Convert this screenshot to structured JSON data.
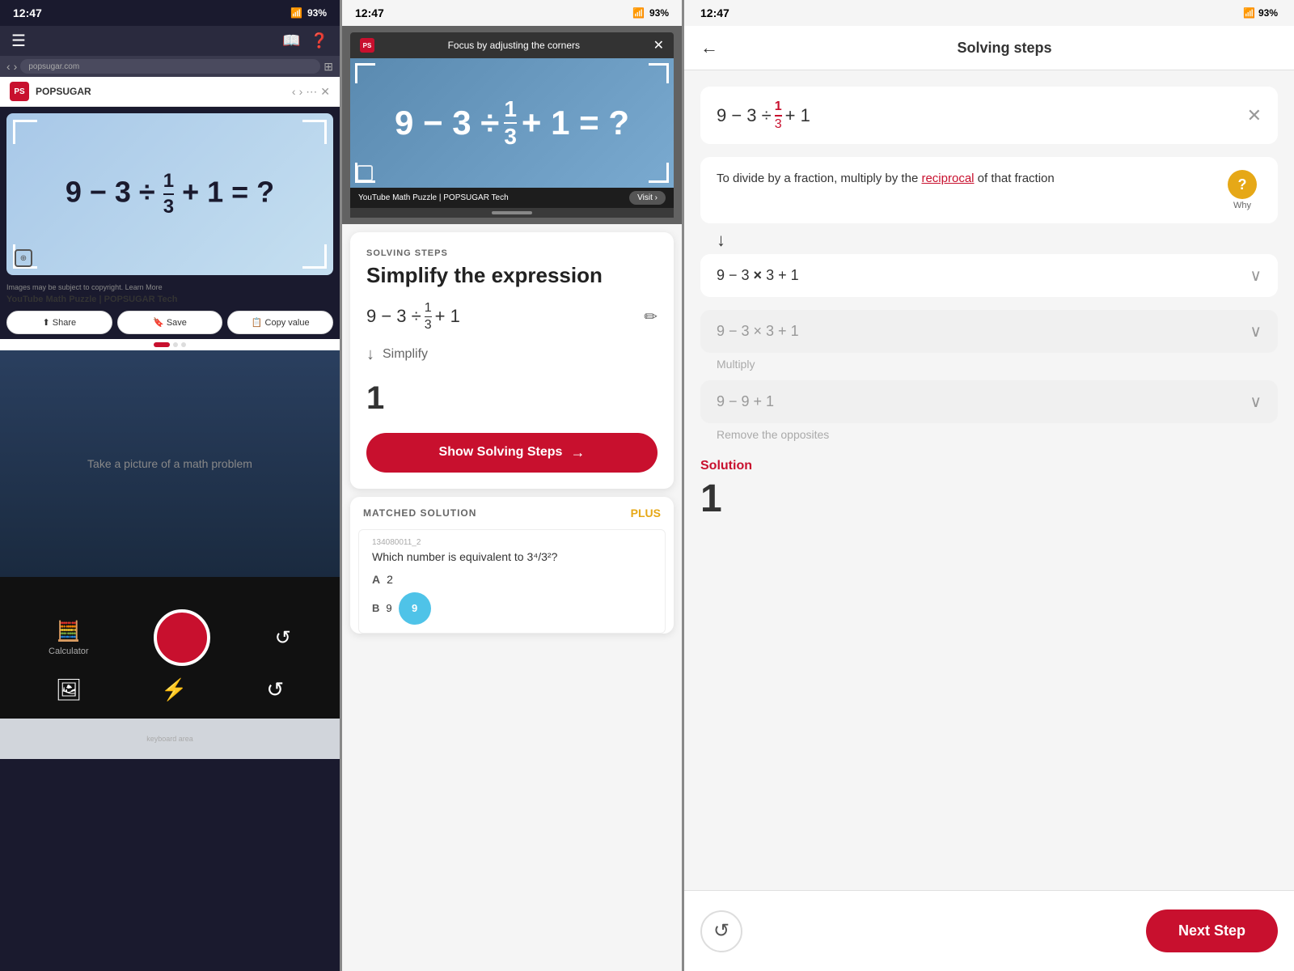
{
  "panel_left": {
    "status_time": "12:47",
    "status_battery": "93%",
    "browser_url": "popsugar.com",
    "popsugar_title": "POPSUGAR",
    "math_expression": "9 − 3 ÷ 1/3 + 1 = ?",
    "image_credit": "Images may be subject to copyright. Learn More",
    "share_btn": "Share",
    "save_btn": "Save",
    "desktop_text": "Take a picture of a math problem",
    "calculator_label": "Calculator",
    "icon_gallery": "🖼",
    "icon_lightning": "⚡",
    "icon_refresh": "↺"
  },
  "panel_middle": {
    "status_time": "12:47",
    "focus_text": "Focus by adjusting the corners",
    "solving_label": "SOLVING STEPS",
    "solving_title": "Simplify the expression",
    "expression": "9 − 3 ÷ 1/3 + 1",
    "simplify_label": "Simplify",
    "result": "1",
    "show_steps_btn": "Show Solving Steps",
    "matched_label": "MATCHED SOLUTION",
    "plus_label": "PLUS",
    "matched_question": "Which number is equivalent to",
    "matched_fraction": "3⁴/3²",
    "matched_a": "2",
    "matched_b": "9"
  },
  "panel_right": {
    "status_time": "12:47",
    "page_title": "Solving steps",
    "equation_display": "9 − 3 ÷ 1/3 + 1",
    "step1_text": "To divide by a fraction, multiply by the",
    "step1_link": "reciprocal",
    "step1_suffix": "of that fraction",
    "why_label": "Why",
    "step2_equation": "9 − 3 × 3 + 1",
    "step3_equation": "9 − 3 × 3 + 1",
    "step3_label": "Multiply",
    "step4_equation": "9 − 9 + 1",
    "step4_label": "Remove the opposites",
    "solution_heading": "Solution",
    "solution_value": "1",
    "next_step_btn": "Next Step",
    "replay_icon": "↺"
  }
}
